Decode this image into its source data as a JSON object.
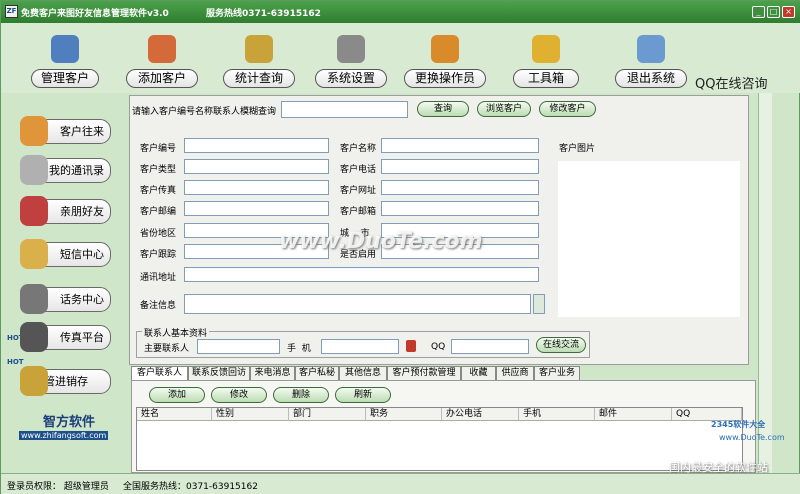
{
  "window": {
    "title": "免费客户来图好友信息管理软件v3.0",
    "hotline": "服务热线0371-63915162",
    "minimize": "_",
    "restore": "□",
    "close": "×",
    "app_icon_text": "ZF"
  },
  "toolbar": {
    "items": [
      {
        "label": "管理客户",
        "icon": "person-icon",
        "color": "#4f7fbf"
      },
      {
        "label": "添加客户",
        "icon": "add-user-icon",
        "color": "#d46a3a"
      },
      {
        "label": "统计查询",
        "icon": "stats-icon",
        "color": "#c9a23a"
      },
      {
        "label": "系统设置",
        "icon": "settings-icon",
        "color": "#8a8a8a"
      },
      {
        "label": "更换操作员",
        "icon": "users-icon",
        "color": "#d98a2a"
      },
      {
        "label": "工具箱",
        "icon": "toolbox-icon",
        "color": "#e0b030"
      },
      {
        "label": "退出系统",
        "icon": "exit-icon",
        "color": "#6a9acf"
      }
    ],
    "qq_label": "QQ在线咨询"
  },
  "sidebar": {
    "items": [
      {
        "label": "客户往来",
        "icon": "coffee-icon",
        "color": "#e0953a"
      },
      {
        "label": "我的通讯录",
        "icon": "phone-book-icon",
        "color": "#b0b0b0"
      },
      {
        "label": "亲朋好友",
        "icon": "friends-icon",
        "color": "#c04040"
      },
      {
        "label": "短信中心",
        "icon": "envelope-icon",
        "color": "#d9b04a"
      },
      {
        "label": "话务中心",
        "icon": "headset-icon",
        "color": "#777777"
      },
      {
        "label": "传真平台",
        "icon": "fax-icon",
        "color": "#555555"
      },
      {
        "label": "管进销存",
        "icon": "inventory-icon",
        "color": "#c9a23a"
      }
    ],
    "hot_badge": "HOT",
    "logo_name": "智方软件",
    "logo_url": "www.zhifangsoft.com"
  },
  "search": {
    "label": "请输入客户编号名称联系人模糊查询",
    "value": "",
    "query_button": "查询",
    "browse_button": "浏览客户",
    "edit_button": "修改客户"
  },
  "form": {
    "left_fields": [
      "客户编号",
      "客户类型",
      "客户传真",
      "客户邮编",
      "省份地区",
      "客户跟踪"
    ],
    "right_fields": [
      "客户名称",
      "客户电话",
      "客户网址",
      "客户邮箱",
      "城    市",
      "是否启用"
    ],
    "address_label": "通讯地址",
    "notes_label": "备注信息",
    "image_label": "客户图片"
  },
  "contact": {
    "group_title": "联系人基本资料",
    "primary_label": "主要联系人",
    "mobile_label": "手  机",
    "qq_label": "QQ",
    "chat_button": "在线交流"
  },
  "tabs": [
    "客户联系人",
    "联系反馈回访",
    "来电消息",
    "客户私秘",
    "其他信息",
    "客户预付款管理",
    "收藏",
    "供应商",
    "客户业务"
  ],
  "grid_actions": {
    "add": "添加",
    "edit": "修改",
    "delete": "删除",
    "refresh": "刷新"
  },
  "grid_columns": [
    "姓名",
    "性别",
    "部门",
    "职务",
    "办公电话",
    "手机",
    "邮件",
    "QQ"
  ],
  "status": {
    "login_role": "登录员权限：  超级管理员",
    "hotline": "全国服务热线：0371-63915162"
  },
  "watermark": {
    "site": "www.DuoTe.com",
    "corner_site": "www.DuoTe.com",
    "corner_tag": "2345软件大全",
    "corner_slogan": "国内最安全的软件站"
  }
}
